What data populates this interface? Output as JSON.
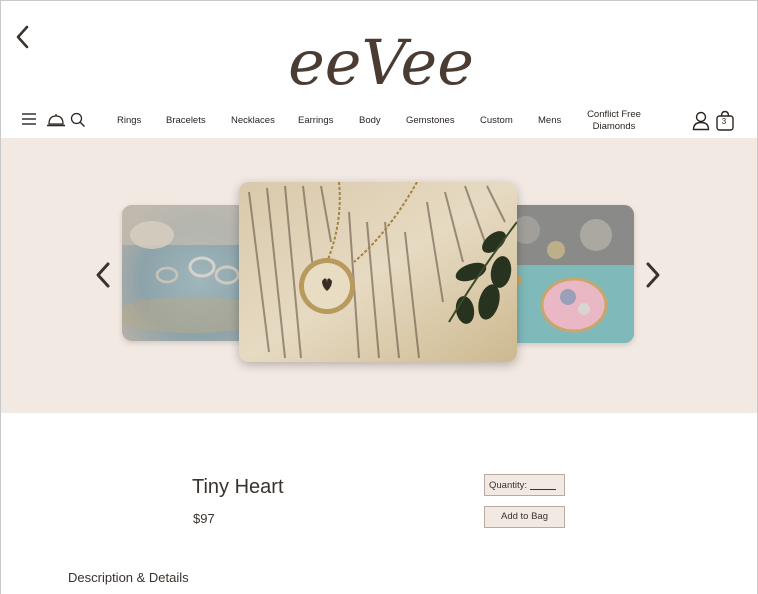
{
  "brand": {
    "logo_text": "eeVee"
  },
  "nav": {
    "links": [
      "Rings",
      "Bracelets",
      "Necklaces",
      "Earrings",
      "Body",
      "Gemstones",
      "Custom",
      "Mens"
    ],
    "conflict_free_line1": "Conflict Free",
    "conflict_free_line2": "Diamonds",
    "bag_count": "3",
    "icons": [
      "menu-icon",
      "service-bell-icon",
      "search-icon",
      "user-icon",
      "shopping-bag-icon"
    ]
  },
  "carousel": {
    "slides": [
      "ring-collection-photo",
      "heart-necklace-on-book-photo",
      "pink-brooch-photo"
    ],
    "active_index": 1
  },
  "product": {
    "title": "Tiny Heart",
    "price": "$97",
    "quantity_label": "Quantity:",
    "add_to_bag_label": "Add to Bag",
    "description_link": "Description & Details"
  },
  "colors": {
    "hero_bg": "#f3e9e3",
    "text_dark": "#3a322e",
    "button_bg": "#f3e9e3",
    "button_border": "#b9a9a0"
  }
}
